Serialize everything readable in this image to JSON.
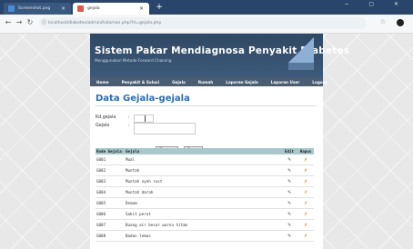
{
  "browser": {
    "tabs": [
      {
        "label": "Screenshot.png",
        "active": false
      },
      {
        "label": "gejala",
        "active": true
      }
    ],
    "url": "localhost/diabetes/admin/halaman.php?hl=gejala.php",
    "new_tab": "+",
    "close": "×",
    "window_controls": "− ▢ ✕"
  },
  "site": {
    "title": "Sistem Pakar Mendiagnosa Penyakit Diabetes",
    "subtitle": "Menggunakan Metode Forward Chaining",
    "menu": [
      "Home",
      "Penyakit & Solusi",
      "Gejala",
      "Rumah",
      "Laporan Gejala",
      "Laporan User",
      "Logout"
    ]
  },
  "page": {
    "heading": "Data Gejala-gejala",
    "form": {
      "kode_label": "Kd.gejala",
      "gejala_label": "Gejala",
      "colon": ":",
      "simpan": "Simpan",
      "reset": "Reset"
    },
    "table": {
      "headers": [
        "Kode Gejala",
        "Gejala",
        "Edit",
        "Hapus"
      ],
      "rows": [
        {
          "kode": "G001",
          "gejala": "Mual"
        },
        {
          "kode": "G002",
          "gejala": "Muntah"
        },
        {
          "kode": "G003",
          "gejala": "Muntah nyeh rust"
        },
        {
          "kode": "G004",
          "gejala": "Muntah darah"
        },
        {
          "kode": "G005",
          "gejala": "Demam"
        },
        {
          "kode": "G006",
          "gejala": "Sakit perut"
        },
        {
          "kode": "G007",
          "gejala": "Buang air besar warna hitam"
        },
        {
          "kode": "G008",
          "gejala": "Badan lemas"
        }
      ],
      "edit_icon": "pencil-icon",
      "delete_icon": "cross-icon"
    }
  }
}
